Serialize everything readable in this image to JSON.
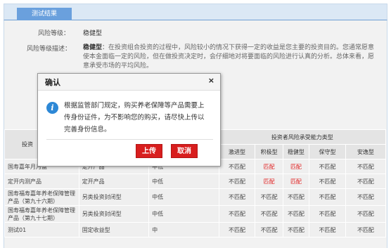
{
  "tab": {
    "label": "测试结果"
  },
  "risk": {
    "level_label": "风险等级：",
    "level_value": "稳健型",
    "desc_label": "风险等级描述：",
    "desc_bold": "稳健型",
    "desc_text": "：在投资组合投资的过程中，风险较小的情况下获得一定的收益是您主要的投资目的。您通常愿意使本金面临一定的风险，但在做投资决定时，会仔细地对将要面临的风险进行认真的分析。总体来看，愿意承受市场的平均风险。"
  },
  "dialog": {
    "title": "确认",
    "close": "×",
    "message": "根据监管部门规定，购买养老保障等产品需要上传身份证件，为不影响您的购买，请尽快上传以完善身份信息。",
    "upload_label": "上传",
    "cancel_label": "取消"
  },
  "table": {
    "col1_header": "投资",
    "group_header": "投资者风险承受能力类型",
    "sub_headers": [
      "激进型",
      "积极型",
      "稳健型",
      "保守型",
      "安逸型"
    ],
    "rows": [
      {
        "name": "国寿嘉年月月盈",
        "type": "定开产品",
        "risk": "中低",
        "m": [
          "不匹配",
          "匹配",
          "匹配",
          "不匹配",
          "不匹配"
        ]
      },
      {
        "name": "定开内测产品",
        "type": "定开产品",
        "risk": "中低",
        "m": [
          "不匹配",
          "匹配",
          "匹配",
          "不匹配",
          "不匹配"
        ]
      },
      {
        "name": "国寿福寿嘉年养老保障管理产品（第九十六期）",
        "type": "另类投资封闭型",
        "risk": "中低",
        "m": [
          "不匹配",
          "不匹配",
          "不匹配",
          "不匹配",
          "不匹配"
        ]
      },
      {
        "name": "国寿福寿嘉年养老保障管理产品（第九十七期）",
        "type": "另类投资封闭型",
        "risk": "中低",
        "m": [
          "不匹配",
          "不匹配",
          "不匹配",
          "不匹配",
          "不匹配"
        ]
      },
      {
        "name": "测试01",
        "type": "固定收益型",
        "risk": "中",
        "m": [
          "不匹配",
          "不匹配",
          "不匹配",
          "不匹配",
          "不匹配"
        ]
      }
    ]
  },
  "colors": {
    "accent_blue": "#6aa0dd",
    "button_red": "#d81e1e",
    "match_red": "#e02020"
  }
}
